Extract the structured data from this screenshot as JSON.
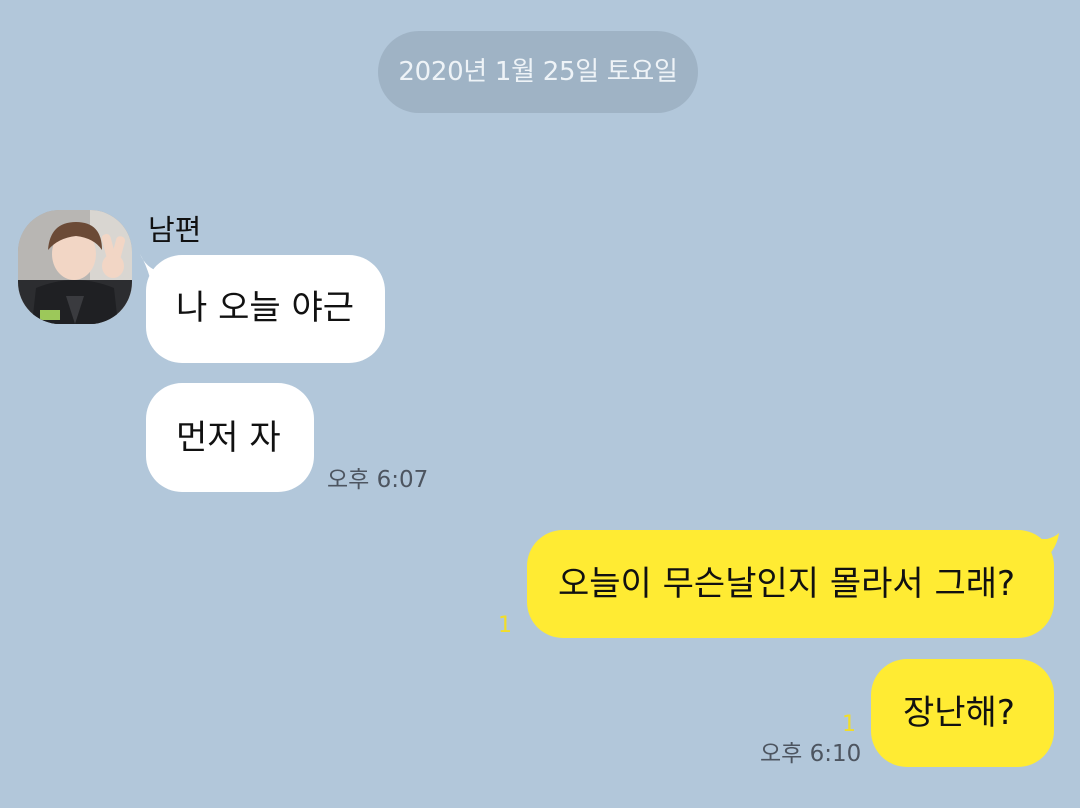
{
  "date_divider": "2020년 1월 25일 토요일",
  "incoming": {
    "sender_name": "남편",
    "messages": [
      {
        "text": "나 오늘 야근"
      },
      {
        "text": "먼저 자",
        "time": "오후 6:07"
      }
    ]
  },
  "outgoing": {
    "messages": [
      {
        "text": "오늘이 무슨날인지 몰라서 그래?",
        "unread_count": "1"
      },
      {
        "text": "장난해?",
        "unread_count": "1",
        "time": "오후 6:10"
      }
    ]
  },
  "colors": {
    "background": "#b2c7da",
    "outgoing_bubble": "#ffeb33",
    "incoming_bubble": "#ffffff",
    "unread_count": "#f2dd28",
    "date_pill": "#9fb3c5"
  },
  "icons": {
    "avatar": "profile-photo-avatar"
  }
}
